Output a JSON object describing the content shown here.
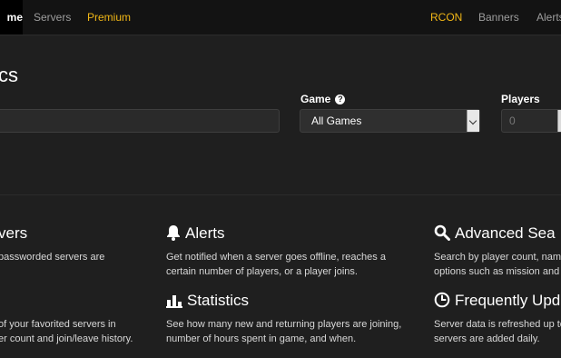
{
  "nav": {
    "home": "me",
    "servers": "Servers",
    "premium": "Premium",
    "rcon": "RCON",
    "banners": "Banners",
    "alerts": "Alerts"
  },
  "page": {
    "title": "cs"
  },
  "filters": {
    "game_label": "Game",
    "game_value": "All Games",
    "players_label": "Players",
    "players_placeholder": "0"
  },
  "features": {
    "col1": {
      "title": "vers",
      "desc1": "passworded servers are",
      "desc2a": "of your favorited servers in",
      "desc2b": "er count and join/leave history."
    },
    "alerts": {
      "title": "Alerts",
      "icon": "bell-icon",
      "desc_line1": "Get notified when a server goes offline, reaches a",
      "desc_line2": "certain number of players, or a player joins."
    },
    "statistics": {
      "title": "Statistics",
      "icon": "bar-chart-icon",
      "desc_line1": "See how many new and returning players are joining,",
      "desc_line2": "number of hours spent in game, and when."
    },
    "advanced_search": {
      "title": "Advanced Sea",
      "icon": "search-icon",
      "desc_line1": "Search by player count, nam",
      "desc_line2": "options such as mission and"
    },
    "frequent_updates": {
      "title": "Frequently Upd",
      "icon": "clock-icon",
      "desc_line1": "Server data is refreshed up to",
      "desc_line2": "servers are added daily."
    }
  },
  "colors": {
    "accent_gold": "#f0b616",
    "background": "#1f1f1f",
    "topbar": "#131313"
  }
}
